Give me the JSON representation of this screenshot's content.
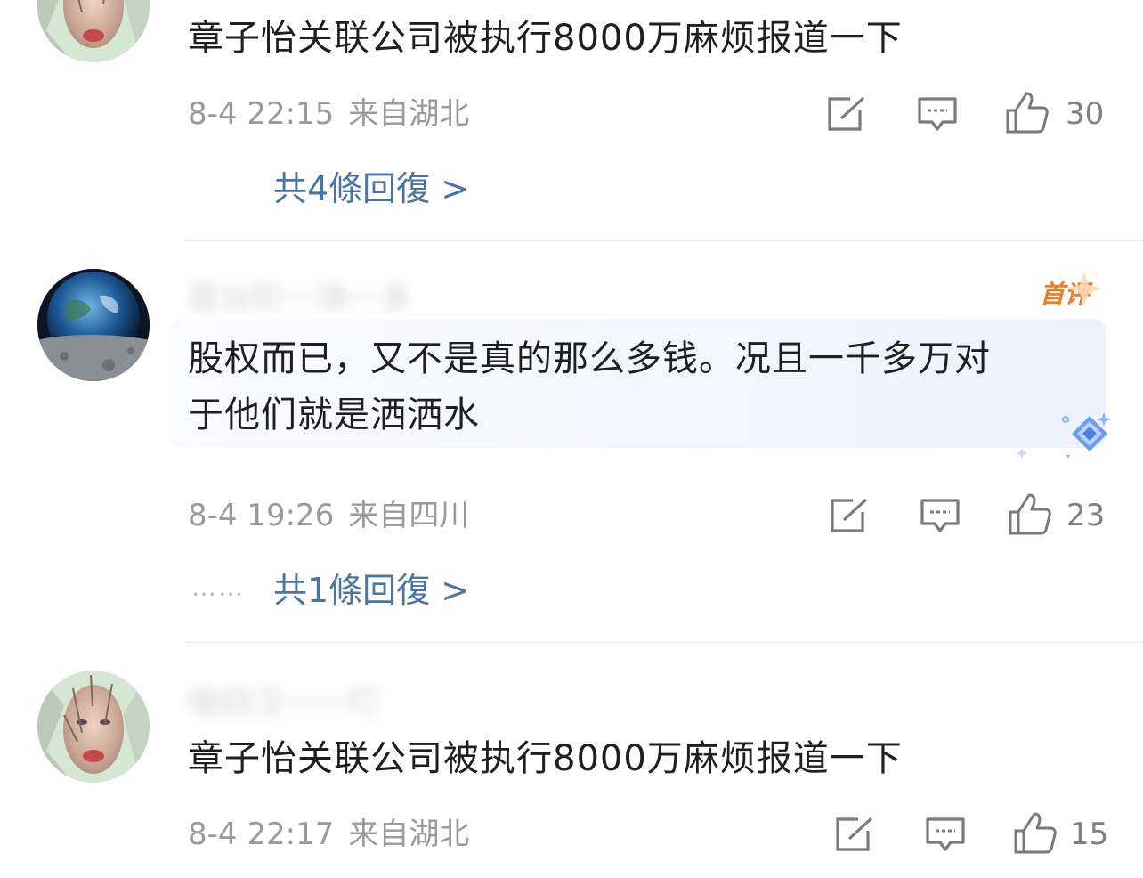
{
  "comments": [
    {
      "text": "章子怡关联公司被执行8000万麻烦报道一下",
      "time": "8-4 22:15",
      "location": "来自湖北",
      "likes": "30",
      "replies": "共4條回復 >"
    },
    {
      "author": "是台阶一场一多",
      "badge": "首评",
      "text_line1": "股权而已，又不是真的那么多钱。况且一千多万对",
      "text_line2": "于他们就是洒洒水",
      "time": "8-4 19:26",
      "location": "来自四川",
      "likes": "23",
      "replies_prefix": "……",
      "replies": "共1條回復 >"
    },
    {
      "author": "喻四汉一一叮",
      "text": "章子怡关联公司被执行8000万麻烦报道一下",
      "time": "8-4 22:17",
      "location": "来自湖北",
      "likes": "15"
    }
  ],
  "icons": [
    "share-icon",
    "comment-icon",
    "like-icon",
    "avatar-portrait",
    "avatar-earth"
  ],
  "colors": {
    "link": "#4a74a6",
    "meta": "#9a9a9a",
    "text": "#1f1f1f",
    "badge": "#f07a22"
  }
}
